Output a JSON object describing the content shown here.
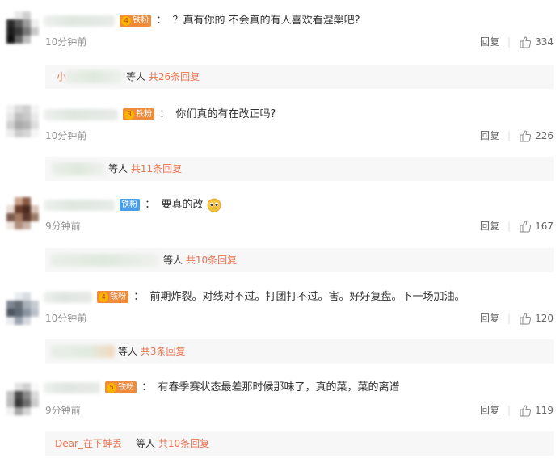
{
  "colors": {
    "fan_badge_orange": "#f08b3a",
    "iron_badge_blue": "#4a9ee6",
    "reply_count_orange": "#eb7350",
    "time_gray": "#939393"
  },
  "reply_label": "回复",
  "comments": [
    {
      "badge": "铁粉",
      "badge_type": "fan-orange",
      "badge_level": "4",
      "colon": "：",
      "content": "？真有你的  不会真的有人喜欢看涅槃吧?",
      "time": "10分钟前",
      "likes": "334",
      "reply_prefix": "小",
      "reply_people": "等人",
      "reply_count": "共26条回复"
    },
    {
      "badge": "铁粉",
      "badge_type": "fan-orange",
      "badge_level": "3",
      "colon": "：",
      "content": "你们真的有在改正吗?",
      "time": "10分钟前",
      "likes": "226",
      "reply_prefix": "",
      "reply_people": "等人",
      "reply_count": "共11条回复"
    },
    {
      "badge": "铁粉",
      "badge_type": "iron-blue",
      "badge_level": "",
      "colon": "：",
      "content": "要真的改",
      "emoji": "pleading-face-emoji",
      "time": "9分钟前",
      "likes": "167",
      "reply_prefix": "",
      "reply_people": "等人",
      "reply_count": "共10条回复"
    },
    {
      "badge": "铁粉",
      "badge_type": "fan-orange",
      "badge_level": "4",
      "colon": "：",
      "content": "前期炸裂。对线对不过。打团打不过。害。好好复盘。下一场加油。",
      "time": "10分钟前",
      "likes": "120",
      "reply_prefix": "",
      "reply_people": "等人",
      "reply_count": "共3条回复"
    },
    {
      "badge": "铁粉",
      "badge_type": "fan-orange",
      "badge_level": "5",
      "colon": "：",
      "content": "有春季赛状态最差那时候那味了，真的菜，菜的离谱",
      "time": "9分钟前",
      "likes": "119",
      "reply_prefix": "Dear_在下蚌丢",
      "reply_people": "等人",
      "reply_count": "共10条回复"
    }
  ]
}
